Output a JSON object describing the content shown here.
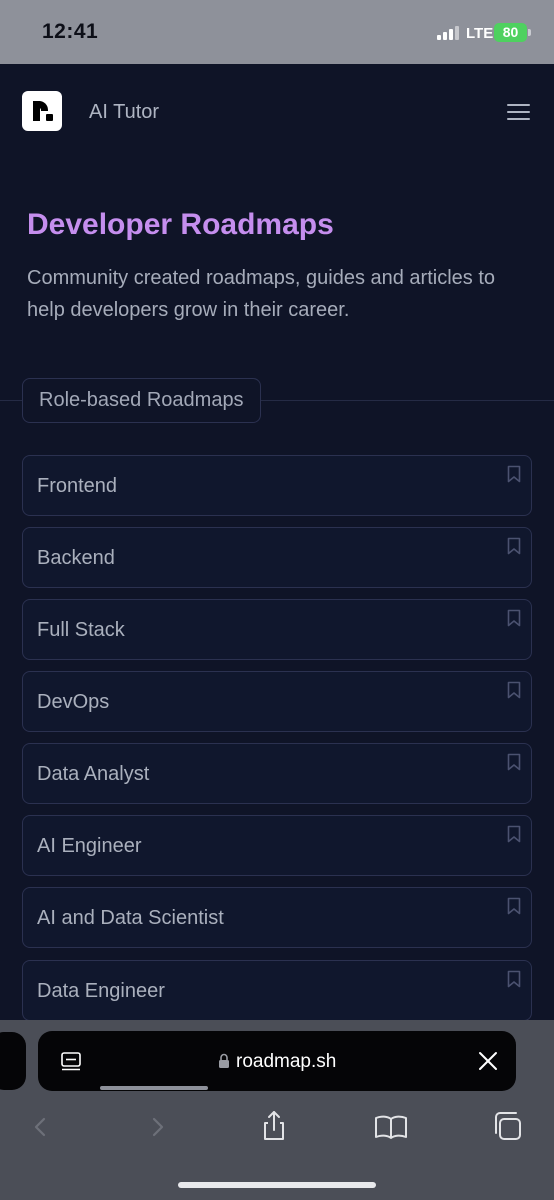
{
  "status_bar": {
    "time": "12:41",
    "network": "LTE",
    "battery": "80"
  },
  "header": {
    "logo_icon": "roadmap-logo",
    "title": "AI Tutor",
    "menu_icon": "hamburger-menu-icon"
  },
  "hero": {
    "title": "Developer Roadmaps",
    "description": "Community created roadmaps, guides and articles to help developers grow in their career."
  },
  "section": {
    "label": "Role-based Roadmaps"
  },
  "roadmaps": [
    {
      "label": "Frontend",
      "icon": "bookmark-icon"
    },
    {
      "label": "Backend",
      "icon": "bookmark-icon"
    },
    {
      "label": "Full Stack",
      "icon": "bookmark-icon"
    },
    {
      "label": "DevOps",
      "icon": "bookmark-icon"
    },
    {
      "label": "Data Analyst",
      "icon": "bookmark-icon"
    },
    {
      "label": "AI Engineer",
      "icon": "bookmark-icon"
    },
    {
      "label": "AI and Data Scientist",
      "icon": "bookmark-icon"
    },
    {
      "label": "Data Engineer",
      "icon": "bookmark-icon"
    }
  ],
  "browser": {
    "url": "roadmap.sh",
    "toolbar_icons": [
      "back-icon",
      "forward-icon",
      "share-icon",
      "bookmarks-icon",
      "tabs-icon"
    ]
  },
  "colors": {
    "page_bg": "#0f1427",
    "title_accent": "#c58eee",
    "card_border": "#2b3150",
    "text_muted": "#aab0bd"
  }
}
